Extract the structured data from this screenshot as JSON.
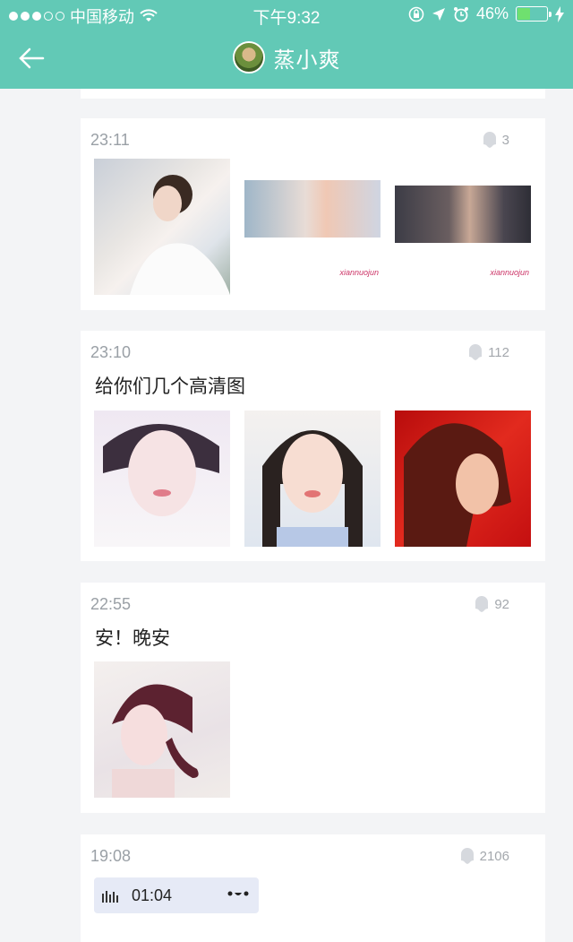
{
  "status_bar": {
    "carrier": "中国移动",
    "time": "下午9:32",
    "battery": "46%",
    "battery_level": 0.46
  },
  "nav": {
    "title": "蒸小爽"
  },
  "posts": [
    {
      "time": "23:11",
      "likes": "3",
      "text": "",
      "watermark_1": "xiannuojun",
      "watermark_2": "xiannuojun"
    },
    {
      "time": "23:10",
      "likes": "112",
      "text": "给你们几个高清图"
    },
    {
      "time": "22:55",
      "likes": "92",
      "text": "安！晚安"
    },
    {
      "time": "19:08",
      "likes": "2106",
      "voice_duration": "01:04"
    }
  ],
  "colors": {
    "header": "#62c9b6",
    "background": "#f3f4f6"
  },
  "icons": [
    "signal-dots-icon",
    "wifi-icon",
    "lock-rotation-icon",
    "location-icon",
    "alarm-icon",
    "battery-icon",
    "charging-icon",
    "back-arrow-icon",
    "like-bubble-icon",
    "audio-wave-icon"
  ]
}
